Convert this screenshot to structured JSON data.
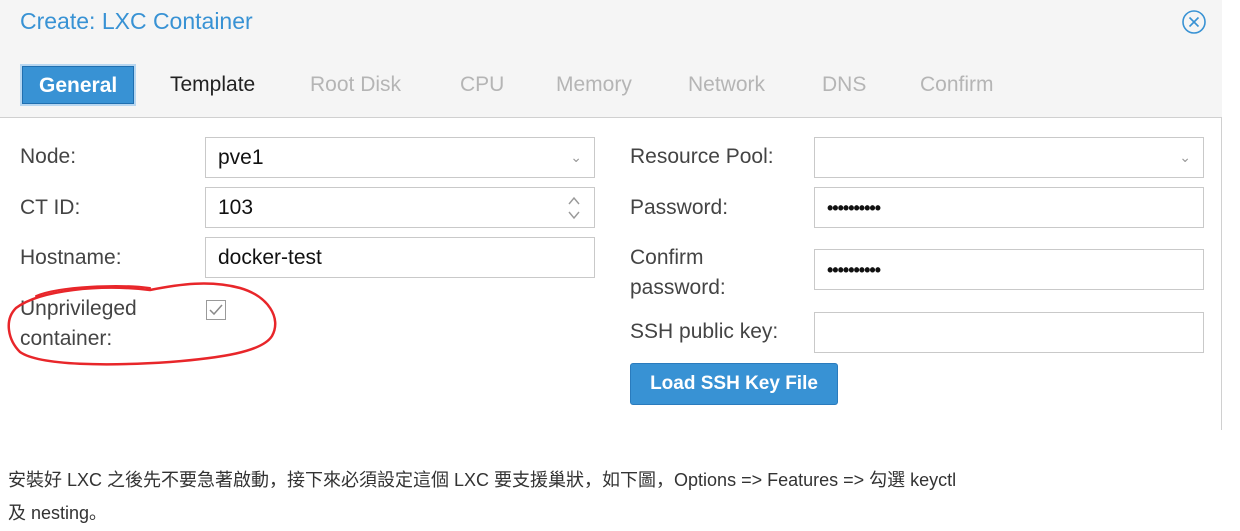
{
  "window": {
    "title": "Create: LXC Container",
    "accent_color": "#3892d4",
    "close_icon": "close-circle-icon"
  },
  "tabs": [
    {
      "label": "General",
      "state": "active"
    },
    {
      "label": "Template",
      "state": "enabled"
    },
    {
      "label": "Root Disk",
      "state": "disabled"
    },
    {
      "label": "CPU",
      "state": "disabled"
    },
    {
      "label": "Memory",
      "state": "disabled"
    },
    {
      "label": "Network",
      "state": "disabled"
    },
    {
      "label": "DNS",
      "state": "disabled"
    },
    {
      "label": "Confirm",
      "state": "disabled"
    }
  ],
  "form_left": {
    "node_label": "Node:",
    "node_value": "pve1",
    "ctid_label": "CT ID:",
    "ctid_value": "103",
    "hostname_label": "Hostname:",
    "hostname_value": "docker-test",
    "unprivileged_label_line1": "Unprivileged",
    "unprivileged_label_line2": "container:",
    "unprivileged_checked": true
  },
  "form_right": {
    "pool_label": "Resource Pool:",
    "pool_value": "",
    "password_label": "Password:",
    "password_value": "••••••••••",
    "confirm_label_line1": "Confirm",
    "confirm_label_line2": "password:",
    "confirm_value": "••••••••••",
    "ssh_label": "SSH public key:",
    "ssh_value": "",
    "load_button": "Load SSH Key File"
  },
  "annotation": {
    "color": "#e8262a",
    "shape": "hand-drawn circle around Unprivileged container option"
  },
  "caption": {
    "line1": "安裝好 LXC 之後先不要急著啟動，接下來必須設定這個 LXC 要支援巢狀，如下圖，Options => Features => 勾選 keyctl",
    "line2": "及 nesting。"
  }
}
